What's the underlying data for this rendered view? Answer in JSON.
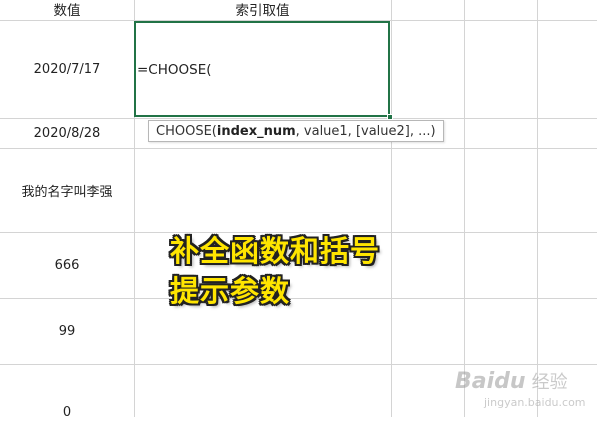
{
  "columns": {
    "a_header": "数值",
    "b_header": "索引取值"
  },
  "rows": [
    {
      "value": "2020/7/17"
    },
    {
      "value": "2020/8/28"
    },
    {
      "value": "我的名字叫李强"
    },
    {
      "value": "666"
    },
    {
      "value": "99"
    },
    {
      "value": "0"
    }
  ],
  "active_cell": {
    "formula": "=CHOOSE("
  },
  "tooltip": {
    "func": "CHOOSE(",
    "arg1": "index_num",
    "rest": ", value1, [value2], ...)"
  },
  "annotation": {
    "line1": "补全函数和括号",
    "line2": "提示参数"
  },
  "watermark": {
    "brand": "Baidu",
    "suffix": "经验",
    "url": "jingyan.baidu.com"
  },
  "colors": {
    "active_border": "#217346",
    "annotation_fill": "#ffe500",
    "gridline": "#d4d4d4"
  }
}
